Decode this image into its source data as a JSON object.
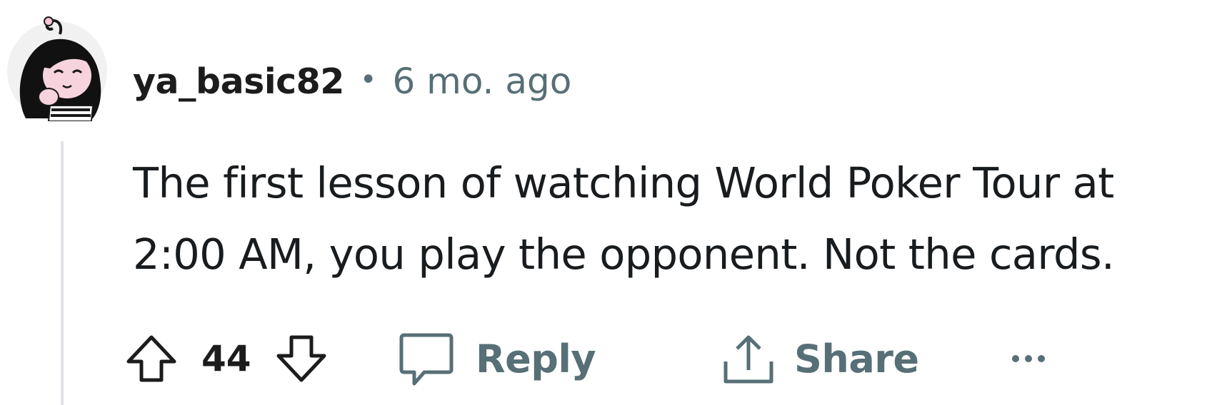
{
  "comment": {
    "username": "ya_basic82",
    "separator": "•",
    "timestamp": "6 mo. ago",
    "body_lines": [
      "The first lesson of watching World Poker Tour at",
      "2:00 AM, you play the opponent. Not the cards."
    ],
    "vote_count": "44",
    "reply_label": "Reply",
    "share_label": "Share",
    "more_label": "···"
  },
  "icons": {
    "upvote": "arrow-up-outline-icon",
    "downvote": "arrow-down-outline-icon",
    "reply": "speech-bubble-icon",
    "share": "share-upload-icon",
    "more": "ellipsis-icon"
  },
  "colors": {
    "username": "#1c1c1c",
    "meta": "#576f76",
    "body": "#181c1f",
    "thread_line": "#e1e3e6"
  }
}
